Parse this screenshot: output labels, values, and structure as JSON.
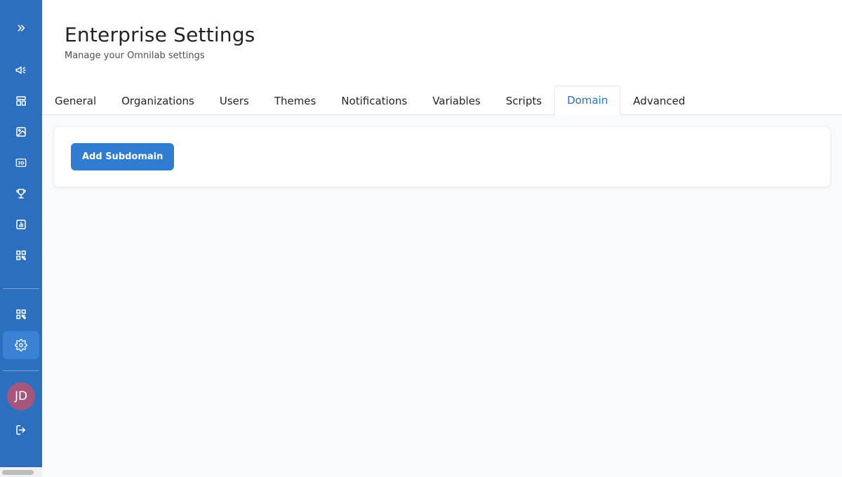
{
  "sidebar": {
    "items": [
      {
        "icon": "chevrons-right-icon"
      },
      {
        "icon": "megaphone-icon"
      },
      {
        "icon": "layout-icon"
      },
      {
        "icon": "image-icon"
      },
      {
        "icon": "3d-icon",
        "label": "3D"
      },
      {
        "icon": "trophy-icon"
      },
      {
        "icon": "chart-icon"
      },
      {
        "icon": "qr-code-icon"
      },
      {
        "icon": "qr-code-icon"
      },
      {
        "icon": "gear-icon",
        "active": true
      },
      {
        "icon": "logout-icon"
      }
    ],
    "avatar_initials": "JD",
    "colors": {
      "background": "#2c6fbe",
      "active": "#3b82d4",
      "avatar": "#a5567c"
    }
  },
  "header": {
    "title": "Enterprise Settings",
    "subtitle": "Manage your Omnilab settings"
  },
  "tabs": [
    {
      "label": "General"
    },
    {
      "label": "Organizations"
    },
    {
      "label": "Users"
    },
    {
      "label": "Themes"
    },
    {
      "label": "Notifications"
    },
    {
      "label": "Variables"
    },
    {
      "label": "Scripts"
    },
    {
      "label": "Domain",
      "active": true
    },
    {
      "label": "Advanced"
    }
  ],
  "domain": {
    "add_button_label": "Add Subdomain"
  },
  "colors": {
    "accent": "#2c6fbe",
    "button": "#2f7cd1"
  }
}
